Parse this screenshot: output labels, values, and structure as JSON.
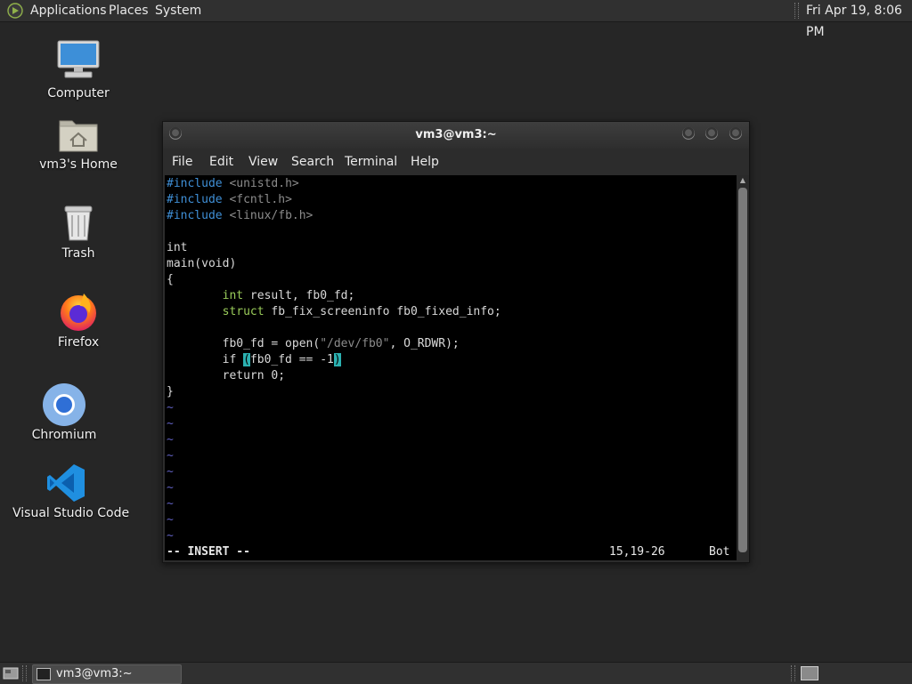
{
  "top_panel": {
    "applications": "Applications",
    "places": "Places",
    "system": "System",
    "clock": "Fri Apr 19,  8:06 PM"
  },
  "desktop_icons": [
    {
      "label": "Computer",
      "icon": "computer-icon"
    },
    {
      "label": "vm3's Home",
      "icon": "home-folder-icon"
    },
    {
      "label": "Trash",
      "icon": "trash-icon"
    },
    {
      "label": "Firefox",
      "icon": "firefox-icon"
    },
    {
      "label": "Chromium",
      "icon": "chromium-icon"
    },
    {
      "label": "Visual Studio Code",
      "icon": "vscode-icon"
    }
  ],
  "terminal": {
    "title": "vm3@vm3:~",
    "menu": [
      "File",
      "Edit",
      "View",
      "Search",
      "Terminal",
      "Help"
    ],
    "code": {
      "l1_kw": "#include",
      "l1_file": " <unistd.h>",
      "l2_kw": "#include",
      "l2_file": " <fcntl.h>",
      "l3_kw": "#include",
      "l3_file": " <linux/fb.h>",
      "l5": "int",
      "l6": "main(void)",
      "l7": "{",
      "l8_indent": "        ",
      "l8_type": "int",
      "l8_rest": " result, fb0_fd;",
      "l9_indent": "        ",
      "l9_type": "struct",
      "l9_rest": " fb_fix_screeninfo fb0_fixed_info;",
      "l11_a": "        fb0_fd = open(",
      "l11_str": "\"/dev/fb0\"",
      "l11_b": ", O_RDWR);",
      "l12_a": "        if ",
      "l12_open": "(",
      "l12_mid": "fb0_fd == -1",
      "l12_close": ")",
      "l13_a": "        return ",
      "l13_num": "0",
      "l13_b": ";",
      "l14": "}",
      "tilde": "~"
    },
    "status_mode": "-- INSERT --",
    "status_position": "15,19-26",
    "status_scroll": "Bot"
  },
  "bottom_panel": {
    "task_label": "vm3@vm3:~"
  },
  "colors": {
    "desktop_bg": "#262626",
    "preproc": "#3f8fd6",
    "type": "#9acc5a",
    "match_paren": "#2bb0b0",
    "tilde": "#6060c0"
  }
}
